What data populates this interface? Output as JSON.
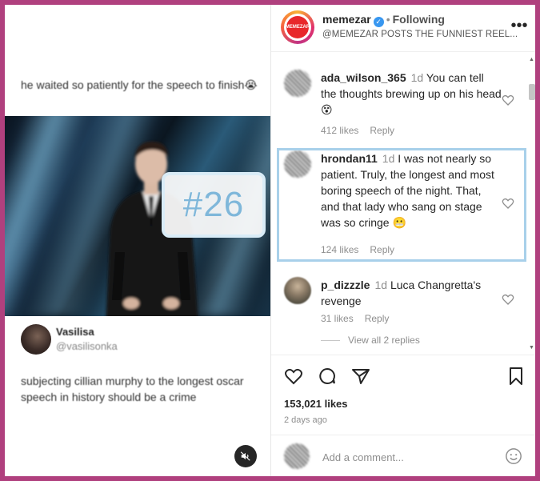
{
  "post": {
    "caption_top": "he waited so patiently for the speech to finish😭",
    "overlay_number": "#26",
    "author_name": "Vasilisa",
    "author_handle": "@vasilisonka",
    "caption_bottom": "subjecting cillian murphy to the longest oscar speech in history should be a crime",
    "mute_icon": "speaker-muted-icon"
  },
  "header": {
    "avatar_text": "MEMEZAR",
    "account": "memezar",
    "separator": "•",
    "following": "Following",
    "subtitle": "@MEMEZAR POSTS THE FUNNIEST REEL...",
    "more_icon": "more-horizontal-icon"
  },
  "comments": [
    {
      "user": "ada_wilson_365",
      "age": "1d",
      "text": "You can tell the thoughts brewing up on his head 😵",
      "likes": "412 likes",
      "reply": "Reply"
    },
    {
      "user": "hrondan11",
      "age": "1d",
      "text": "I was not nearly so patient. Truly, the longest and most boring speech of the night. That, and that lady who sang on stage was so cringe 😬",
      "likes": "124 likes",
      "reply": "Reply"
    },
    {
      "user": "p_dizzzle",
      "age": "1d",
      "text": "Luca Changretta's revenge",
      "likes": "31 likes",
      "reply": "Reply"
    }
  ],
  "view_replies": "View all 2 replies",
  "actions": {
    "like_icon": "heart-icon",
    "comment_icon": "comment-icon",
    "share_icon": "send-icon",
    "save_icon": "bookmark-icon",
    "likes": "153,021 likes",
    "posted": "2 days ago"
  },
  "add_comment": {
    "placeholder": "Add a comment...",
    "emoji_icon": "emoji-icon"
  },
  "colors": {
    "border": "#b0407e",
    "highlight": "#a8d0ea",
    "badge_text": "#7fb7da",
    "verified": "#3897f0"
  }
}
